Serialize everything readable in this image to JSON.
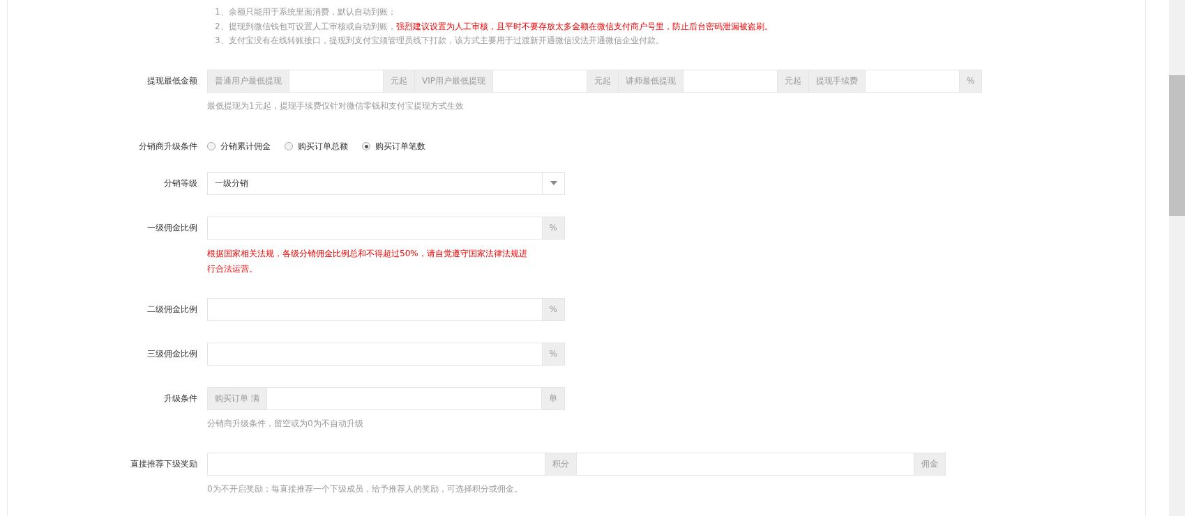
{
  "notes": [
    {
      "text": "1、余额只能用于系统里面消费，默认自动到账；"
    },
    {
      "text": "2、提现到微信钱包可设置人工审核或自动到账，",
      "warning": "强烈建议设置为人工审核，且平时不要存放太多金额在微信支付商户号里，防止后台密码泄漏被盗刷。"
    },
    {
      "text": "3、支付宝没有在线转账接口，提现到支付宝须管理员线下打款，该方式主要用于过渡新开通微信没法开通微信企业付款。"
    }
  ],
  "rows": [
    {
      "kind": "inputs",
      "label": "提现最低金额",
      "parts": [
        {
          "kind": "addon",
          "text": "普通用户最低提现"
        },
        {
          "kind": "input"
        },
        {
          "kind": "addon",
          "text": "元起"
        },
        {
          "kind": "addon",
          "text": "VIP用户最低提现"
        },
        {
          "kind": "input"
        },
        {
          "kind": "addon",
          "text": "元起"
        },
        {
          "kind": "addon",
          "text": "讲师最低提现"
        },
        {
          "kind": "input"
        },
        {
          "kind": "addon",
          "text": "元起"
        },
        {
          "kind": "addon",
          "text": "提现手续费"
        },
        {
          "kind": "input"
        },
        {
          "kind": "addon",
          "text": "%"
        }
      ],
      "help": "最低提现为1元起，提现手续费仅针对微信零钱和支付宝提现方式生效"
    },
    {
      "kind": "radio",
      "label": "分销商升级条件",
      "options": [
        {
          "label": "分销累计佣金",
          "selected": false
        },
        {
          "label": "购买订单总额",
          "selected": false
        },
        {
          "label": "购买订单笔数",
          "selected": true
        }
      ]
    },
    {
      "kind": "select",
      "label": "分销等级",
      "value": "一级分销"
    },
    {
      "kind": "inputs",
      "label": "一级佣金比例",
      "parts": [
        {
          "kind": "input"
        },
        {
          "kind": "addon",
          "text": "%"
        }
      ],
      "warning": "根据国家相关法规，各级分销佣金比例总和不得超过50%，请自觉遵守国家法律法规进行合法运营。"
    },
    {
      "kind": "inputs",
      "label": "二级佣金比例",
      "parts": [
        {
          "kind": "input"
        },
        {
          "kind": "addon",
          "text": "%"
        }
      ]
    },
    {
      "kind": "inputs",
      "label": "三级佣金比例",
      "parts": [
        {
          "kind": "input"
        },
        {
          "kind": "addon",
          "text": "%"
        }
      ]
    },
    {
      "kind": "inputs",
      "label": "升级条件",
      "parts": [
        {
          "kind": "addon",
          "text": "购买订单 满"
        },
        {
          "kind": "input"
        },
        {
          "kind": "addon",
          "text": "单"
        }
      ],
      "help": "分销商升级条件，留空或为0为不自动升级"
    },
    {
      "kind": "inputs",
      "label": "直接推荐下级奖励",
      "parts": [
        {
          "kind": "input"
        },
        {
          "kind": "addon",
          "text": "积分"
        },
        {
          "kind": "input"
        },
        {
          "kind": "addon",
          "text": "佣金"
        }
      ],
      "help": "0为不开启奖励；每直接推荐一个下级成员，给予推荐人的奖励，可选择积分或佣金。"
    }
  ]
}
